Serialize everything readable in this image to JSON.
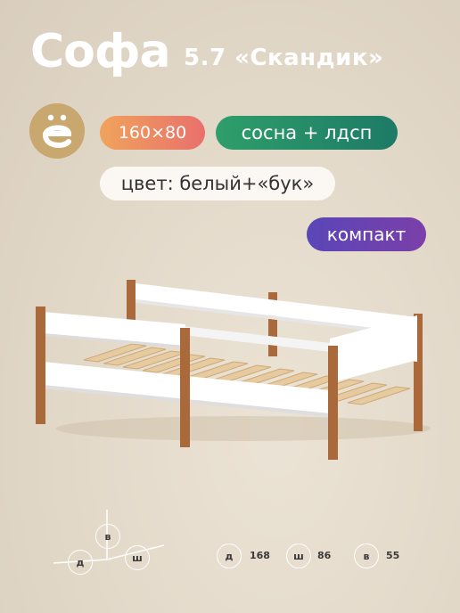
{
  "product": {
    "title": "Софа",
    "model": "5.7 «Скандик»"
  },
  "logo": {
    "letter": "ё",
    "icon": "yo-letter-logo-icon",
    "color": "#c9a86f"
  },
  "badges": {
    "size": "160×80",
    "material": "сосна + лдсп",
    "color": "цвет: белый+«бук»",
    "type": "компакт"
  },
  "axis_labels": {
    "height": "в",
    "length": "д",
    "width": "ш"
  },
  "dimensions": [
    {
      "key": "д",
      "value": "168"
    },
    {
      "key": "ш",
      "value": "86"
    },
    {
      "key": "в",
      "value": "55"
    }
  ],
  "colors": {
    "background": "#e2d8c8",
    "wood": "#a9693a",
    "panel": "#ffffff",
    "slats": "#e2c9a0"
  }
}
